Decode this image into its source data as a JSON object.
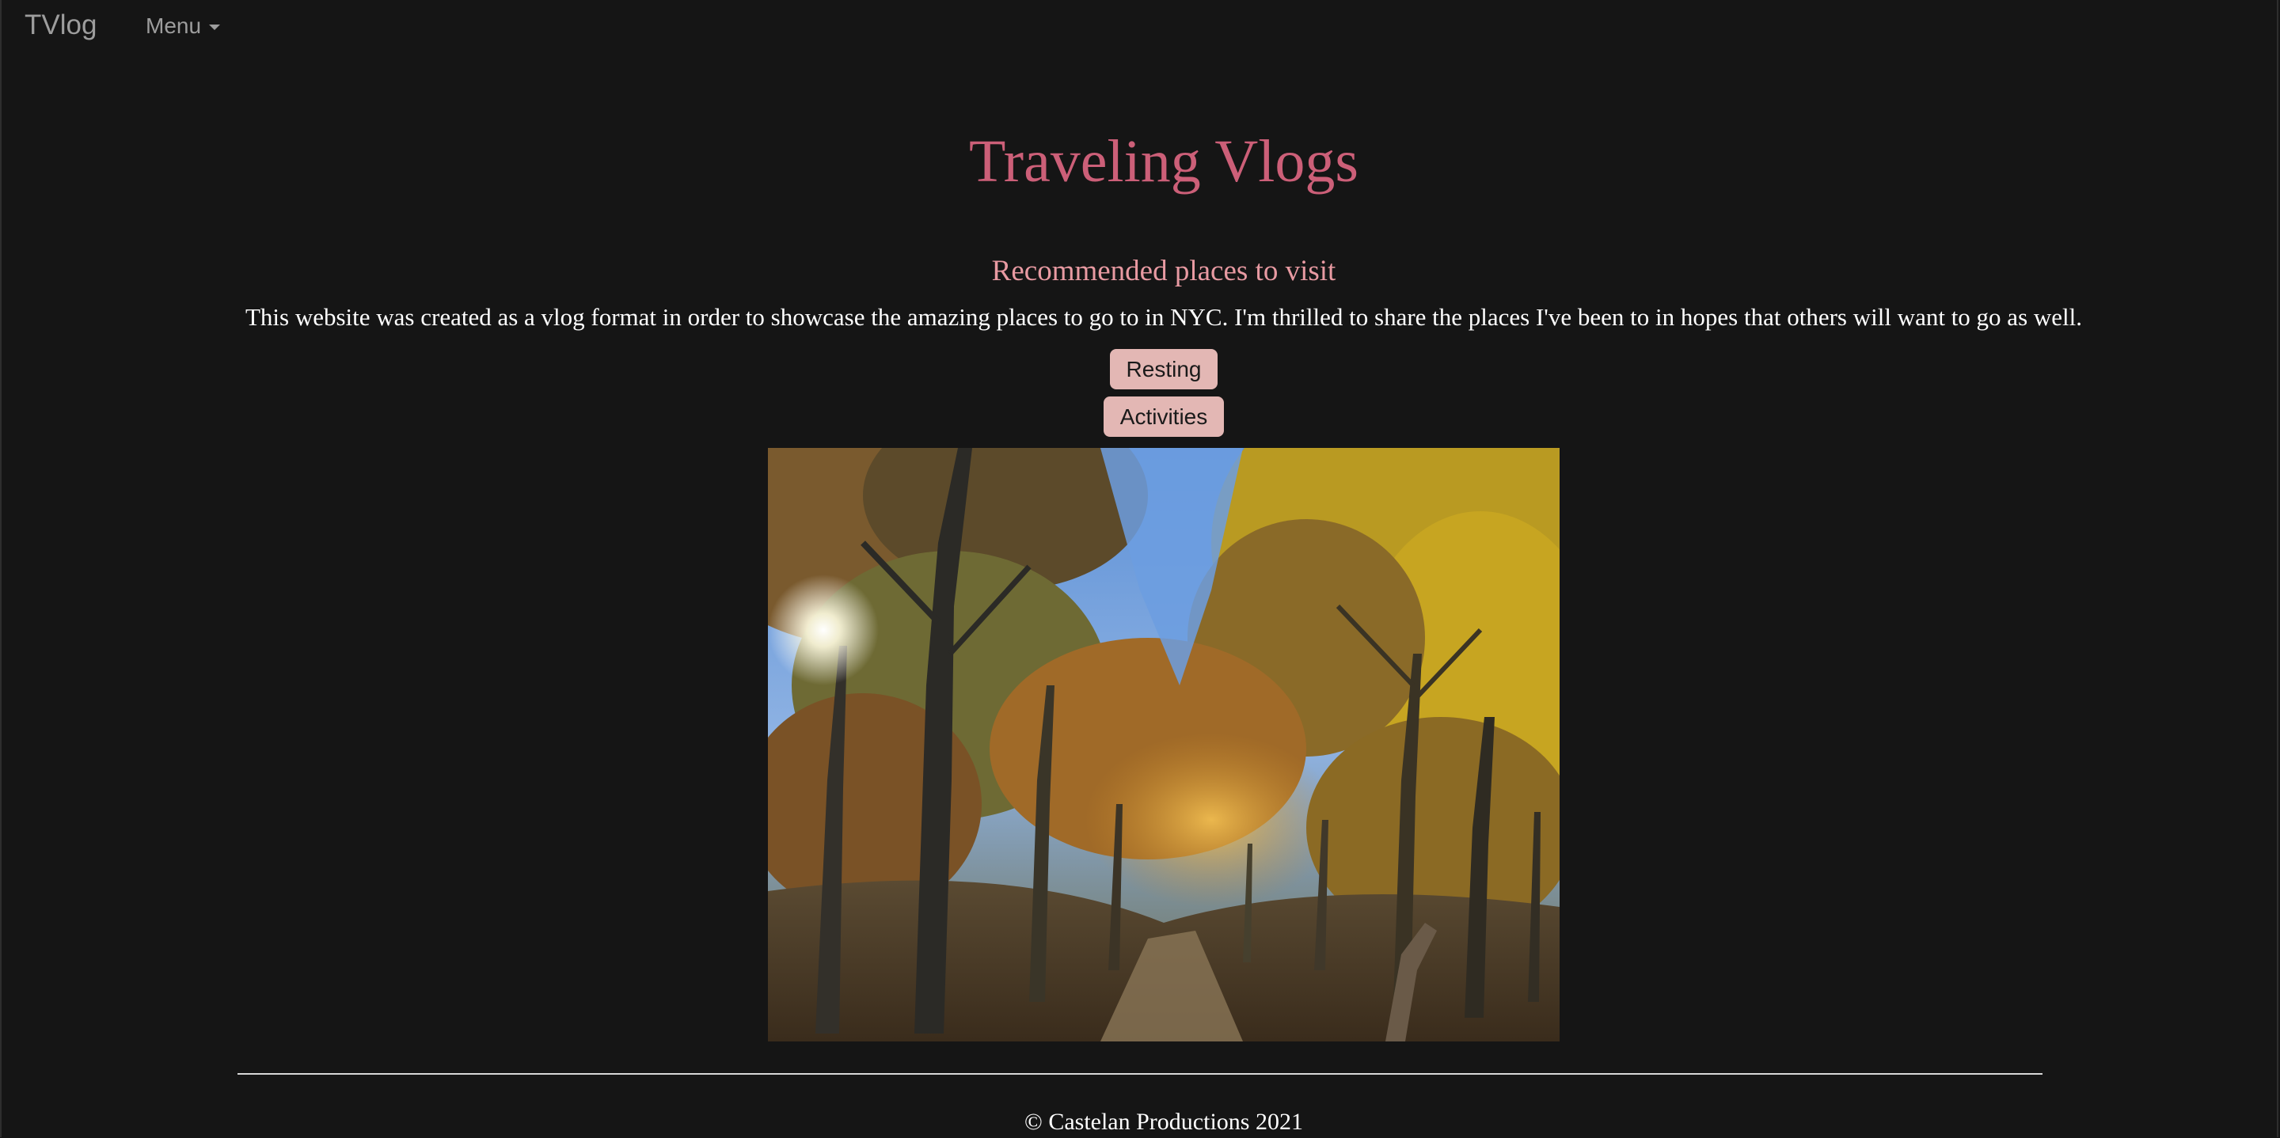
{
  "navbar": {
    "brand": "TVlog",
    "menu_label": "Menu"
  },
  "main": {
    "title": "Traveling Vlogs",
    "subtitle": "Recommended places to visit",
    "description": "This website was created as a vlog format in order to showcase the amazing places to go to in NYC. I'm thrilled to share the places I've been to in hopes that others will want to go as well.",
    "buttons": {
      "resting": "Resting",
      "activities": "Activities"
    },
    "photo": {
      "subject": "autumn forest trail under a tree canopy with sun flare"
    }
  },
  "footer": {
    "copyright": "© Castelan Productions 2021"
  },
  "colors": {
    "background": "#151515",
    "brand_text": "#9d9d9d",
    "title": "#cc5f78",
    "subtitle": "#e89aa2",
    "button_bg": "#e3b7b4",
    "button_text": "#1a1a1a"
  }
}
